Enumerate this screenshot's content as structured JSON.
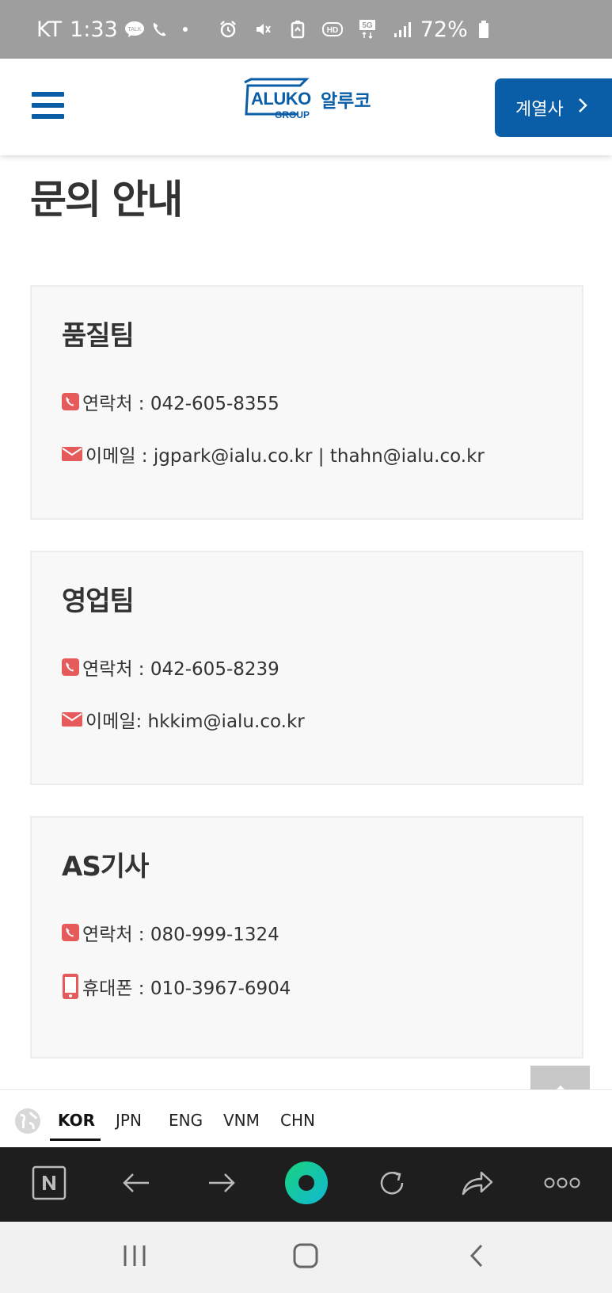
{
  "status_bar": {
    "carrier": "KT",
    "time": "1:33",
    "battery": "72%"
  },
  "header": {
    "logo_text": "ALUKO",
    "logo_korean": "알루코",
    "logo_sub": "GROUP",
    "affiliate_label": "계열사"
  },
  "page": {
    "title": "문의 안내"
  },
  "cards": [
    {
      "title": "품질팀",
      "phone": "연락처 : 042-605-8355",
      "email": "이메일 : jgpark@ialu.co.kr | thahn@ialu.co.kr"
    },
    {
      "title": "영업팀",
      "phone": "연락처 : 042-605-8239",
      "email": "이메일: hkkim@ialu.co.kr"
    },
    {
      "title": "AS기사",
      "phone": "연락처 : 080-999-1324",
      "mobile": "휴대폰 : 010-3967-6904"
    }
  ],
  "languages": {
    "items": [
      "KOR",
      "JPN",
      "ENG",
      "VNM",
      "CHN"
    ],
    "selected": "KOR"
  },
  "colors": {
    "brand_blue": "#0a5ea8",
    "icon_red": "#e55a5a",
    "status_bar_bg": "#9e9e9e",
    "browser_bar_bg": "#1e1e1e"
  },
  "icons": {
    "phone": "phone-icon",
    "email": "envelope-icon",
    "mobile": "mobile-phone-icon",
    "scroll_top": "arrow-up-icon",
    "globe": "globe-icon"
  }
}
